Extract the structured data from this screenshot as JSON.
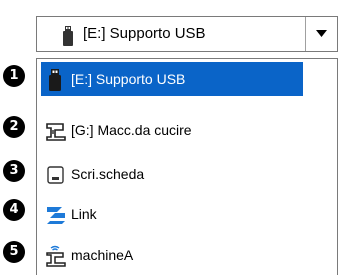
{
  "combo": {
    "selected_label": "[E:] Supporto USB",
    "icon": "usb-drive-icon",
    "arrow_icon": "dropdown-arrow-icon"
  },
  "list": {
    "selected_index": 0,
    "selection_color": "#0a64c8",
    "items": [
      {
        "number": "1",
        "label": "[E:] Supporto USB",
        "icon": "usb-drive-icon"
      },
      {
        "number": "2",
        "label": "[G:] Macc.da cucire",
        "icon": "sewing-machine-icon"
      },
      {
        "number": "3",
        "label": "Scri.scheda",
        "icon": "card-writer-icon"
      },
      {
        "number": "4",
        "label": "Link",
        "icon": "link-icon"
      },
      {
        "number": "5",
        "label": "machineA",
        "icon": "wireless-machine-icon"
      }
    ]
  }
}
